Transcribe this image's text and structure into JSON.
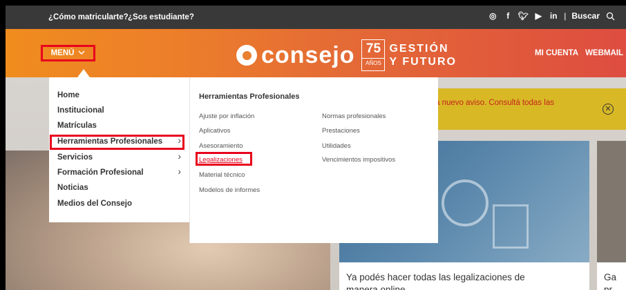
{
  "topbar": {
    "link1": "¿Cómo matricularte?",
    "link2": "¿Sos estudiante?",
    "social_icons": [
      "instagram-icon",
      "facebook-icon",
      "twitter-icon",
      "youtube-icon",
      "linkedin-icon"
    ],
    "search_label": "Buscar"
  },
  "header": {
    "menu_label": "MENÚ",
    "logo_word": "consejo",
    "logo_75": "75",
    "logo_anos": "AÑOS",
    "logo_line1": "GESTIÓN",
    "logo_line2": "Y FUTURO",
    "link_account": "MI CUENTA",
    "link_webmail": "WEBMAIL"
  },
  "menu": {
    "items": [
      {
        "label": "Home"
      },
      {
        "label": "Institucional"
      },
      {
        "label": "Matrículas"
      },
      {
        "label": "Herramientas Profesionales",
        "arrow": "›"
      },
      {
        "label": "Servicios",
        "arrow": "›"
      },
      {
        "label": "Formación Profesional",
        "arrow": "›"
      },
      {
        "label": "Noticias"
      },
      {
        "label": "Medios del Consejo"
      }
    ]
  },
  "submenu": {
    "title": "Herramientas Profesionales",
    "col1": [
      "Ajuste por inflación",
      "Aplicativos",
      "Asesoramiento",
      "Legalizaciones",
      "Material técnico",
      "Modelos de informes"
    ],
    "col2": [
      "Normas profesionales",
      "Prestaciones",
      "Utilidades",
      "Vencimientos impositivos"
    ]
  },
  "alert": {
    "text": "a nuevo aviso. Consultá todas las",
    "close": "✕"
  },
  "cards": {
    "card1_line1": "Ya podés hacer todas las legalizaciones de",
    "card1_line2": "manera online",
    "card2_line1": "Ga",
    "card2_line2": "pr"
  },
  "colors": {
    "topbar": "#3a3939",
    "header_start": "#f08c1e",
    "header_end": "#de4d40",
    "highlight": "#e8001c",
    "alert_bg": "#d9b826"
  }
}
